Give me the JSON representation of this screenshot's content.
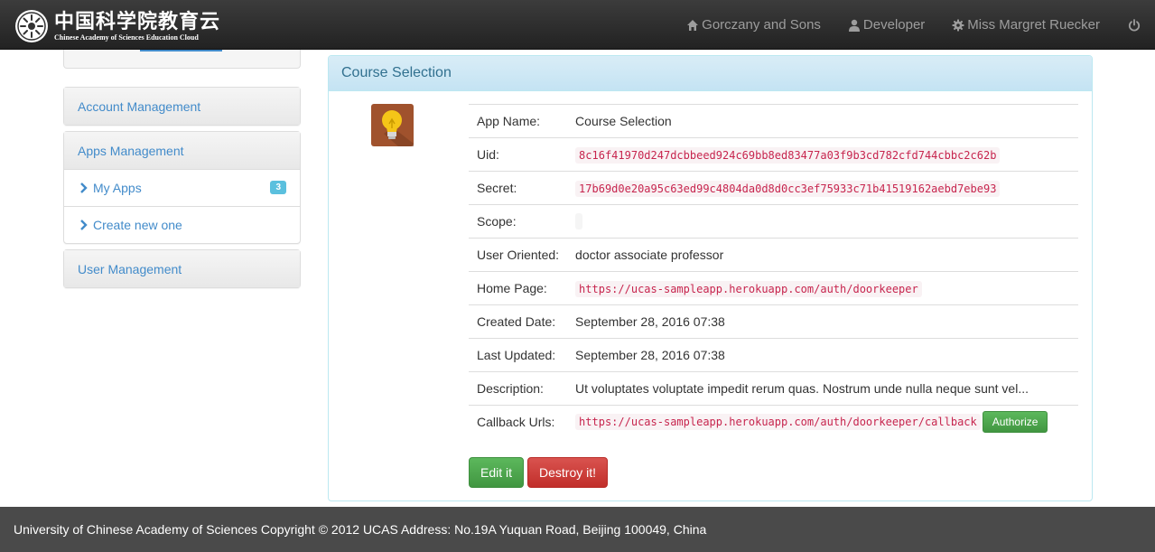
{
  "brand": {
    "name_cn": "中国科学院教育云",
    "name_en": "Chinese Academy of Sciences Education Cloud",
    "icon": "cas-seal-logo"
  },
  "navbar": {
    "items": [
      {
        "label": "Gorczany and Sons",
        "icon": "home-icon"
      },
      {
        "label": "Developer",
        "icon": "user-icon"
      },
      {
        "label": "Miss Margret Ruecker",
        "icon": "gear-icon"
      }
    ],
    "power_icon": "power-icon"
  },
  "sidebar": {
    "account": {
      "label": "Account Management"
    },
    "apps": {
      "label": "Apps Management",
      "items": [
        {
          "label": "My Apps",
          "badge": "3"
        },
        {
          "label": "Create new one"
        }
      ]
    },
    "users": {
      "label": "User Management"
    }
  },
  "panel": {
    "title": "Course Selection",
    "icon": "lightbulb-icon",
    "rows": {
      "app_name": {
        "label": "App Name:",
        "value": "Course Selection"
      },
      "uid": {
        "label": "Uid:",
        "value": "8c16f41970d247dcbbeed924c69bb8ed83477a03f9b3cd782cfd744cbbc2c62b"
      },
      "secret": {
        "label": "Secret:",
        "value": "17b69d0e20a95c63ed99c4804da0d8d0cc3ef75933c71b41519162aebd7ebe93"
      },
      "scope": {
        "label": "Scope:",
        "value": ""
      },
      "user_oriented": {
        "label": "User Oriented:",
        "value": "doctor associate professor"
      },
      "home_page": {
        "label": "Home Page:",
        "value": "https://ucas-sampleapp.herokuapp.com/auth/doorkeeper"
      },
      "created": {
        "label": "Created Date:",
        "value": "September 28, 2016 07:38"
      },
      "updated": {
        "label": "Last Updated:",
        "value": "September 28, 2016 07:38"
      },
      "description": {
        "label": "Description:",
        "value": "Ut voluptates voluptate impedit rerum quas. Nostrum unde nulla neque sunt vel..."
      },
      "callback": {
        "label": "Callback Urls:",
        "value": "https://ucas-sampleapp.herokuapp.com/auth/doorkeeper/callback",
        "authorize_label": "Authorize"
      }
    },
    "edit_label": "Edit it",
    "destroy_label": "Destroy it!"
  },
  "footer": {
    "text": "University of Chinese Academy of Sciences Copyright © 2012 UCAS Address: No.19A Yuquan Road, Beijing 100049, China"
  },
  "colors": {
    "navbar": "#222222",
    "link": "#428bca",
    "panel_header": "#d9edf7",
    "success": "#5cb85c",
    "danger": "#d9534f",
    "code": "#c7254e",
    "footer": "#4a4a4a"
  }
}
